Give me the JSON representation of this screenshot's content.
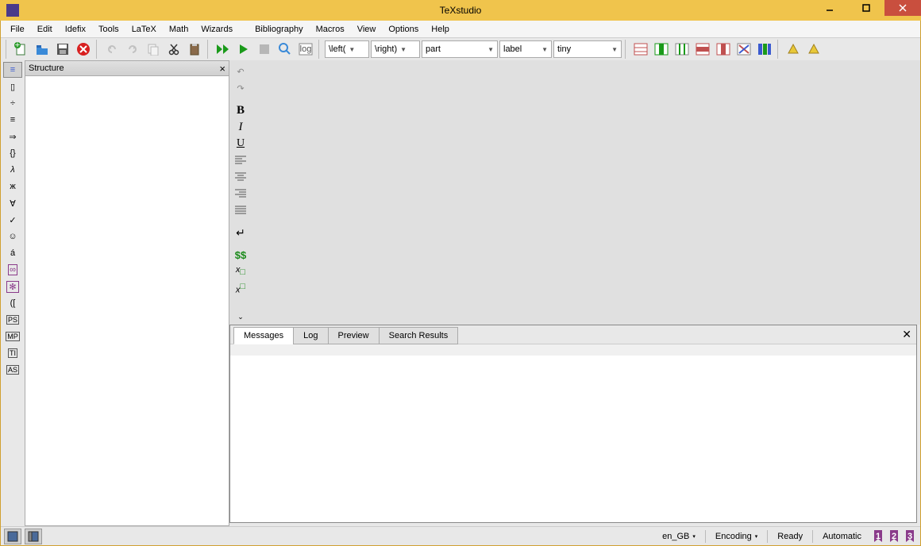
{
  "window": {
    "title": "TeXstudio"
  },
  "menu": [
    "File",
    "Edit",
    "Idefix",
    "Tools",
    "LaTeX",
    "Math",
    "Wizards",
    "Bibliography",
    "Macros",
    "View",
    "Options",
    "Help"
  ],
  "toolbar_combos": {
    "left_delim": "\\left(",
    "right_delim": "\\right)",
    "section": "part",
    "ref": "label",
    "size": "tiny"
  },
  "structure": {
    "title": "Structure"
  },
  "left_icons": [
    "structure",
    "bookmarks",
    "symbols-operators",
    "symbols-relations",
    "symbols-arrows",
    "symbols-delimiters",
    "symbols-greek",
    "symbols-cyrillic",
    "symbols-misc-math",
    "symbols-misc-text",
    "symbols-faces",
    "symbols-accented",
    "symbols-special",
    "symbols-favorites",
    "left-right",
    "pstricks",
    "metapost",
    "tikz",
    "asymptote"
  ],
  "left_icon_glyphs": [
    "≡",
    "▯",
    "÷",
    "≡",
    "⇒",
    "{}",
    "λ",
    "ж",
    "∀",
    "✓",
    "☺",
    "á",
    "∞",
    "✻",
    "([",
    "PS",
    "MP",
    "TI",
    "AS"
  ],
  "editor_icons": [
    "undo",
    "redo",
    "bold",
    "italic",
    "underline",
    "align-left",
    "align-center",
    "align-right",
    "align-justify",
    "newline",
    "inline-math",
    "subscript",
    "superscript"
  ],
  "editor_icon_glyphs": [
    "↶",
    "↷",
    "B",
    "I",
    "U",
    "≡",
    "≡",
    "≡",
    "≡",
    "↵",
    "$$",
    "x",
    "x"
  ],
  "bottom_tabs": [
    "Messages",
    "Log",
    "Preview",
    "Search Results"
  ],
  "status": {
    "lang": "en_GB",
    "encoding": "Encoding",
    "ready": "Ready",
    "auto": "Automatic",
    "badges": [
      "1",
      "2",
      "3"
    ]
  }
}
